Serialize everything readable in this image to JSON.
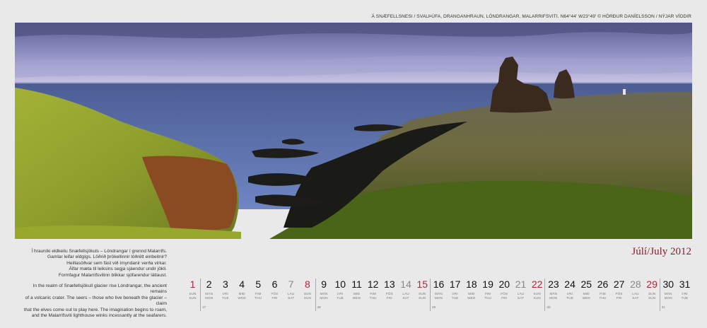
{
  "photo_caption": "Á Snæfellsnesi / Svalþúfa, Dranganhraun, Lóndrangar, Malarrifsviti. N64°44' W23°49' © Hörður Daníelsson / Nýjar víddir",
  "poem_is": [
    "Í hrauníki eldkeilu Snæfellsjökuls – Lóndrangar í grennd Malarrifs.",
    "Gamlar leifar eldgígs. Löðrið þrökellinnir löðrétt einbeitnir?",
    "Heillasöðvar sem fást við ímyndanir verða virkar.",
    "Álfar mæta til leiksins segja sjáendur undir jökli.",
    "Formfagur Malarrifsvitinn blikkar sjófarendur látlaust."
  ],
  "poem_en": [
    "In the realm of Snæfellsjökull glacier rise Lóndrangar, the ancient remains",
    "of a volcanic crater. The seers – those who live beneath the glacier – claim",
    "that the elves come out to play here. The imagination begins to roam,",
    "and the Malarrifsviti lighthouse winks incessantly at the seafarers."
  ],
  "month_title": "Júlí/July 2012",
  "week_numbers": [
    "27",
    "28",
    "29",
    "30",
    "31"
  ],
  "days": [
    {
      "n": "1",
      "is": "SUN",
      "en": "SUN",
      "type": "sun"
    },
    {
      "n": "2",
      "is": "MÁN",
      "en": "MON",
      "type": "wd"
    },
    {
      "n": "3",
      "is": "ÞRI",
      "en": "TUE",
      "type": "wd"
    },
    {
      "n": "4",
      "is": "MIÐ",
      "en": "WED",
      "type": "wd"
    },
    {
      "n": "5",
      "is": "FIM",
      "en": "THU",
      "type": "wd"
    },
    {
      "n": "6",
      "is": "FÖS",
      "en": "FRI",
      "type": "wd"
    },
    {
      "n": "7",
      "is": "LAU",
      "en": "SAT",
      "type": "sat"
    },
    {
      "n": "8",
      "is": "SUN",
      "en": "SUN",
      "type": "sun"
    },
    {
      "n": "9",
      "is": "MÁN",
      "en": "MON",
      "type": "wd"
    },
    {
      "n": "10",
      "is": "ÞRI",
      "en": "TUE",
      "type": "wd"
    },
    {
      "n": "11",
      "is": "MIÐ",
      "en": "WED",
      "type": "wd"
    },
    {
      "n": "12",
      "is": "FIM",
      "en": "THU",
      "type": "wd"
    },
    {
      "n": "13",
      "is": "FÖS",
      "en": "FRI",
      "type": "wd"
    },
    {
      "n": "14",
      "is": "LAU",
      "en": "SAT",
      "type": "sat"
    },
    {
      "n": "15",
      "is": "SUN",
      "en": "SUN",
      "type": "sun"
    },
    {
      "n": "16",
      "is": "MÁN",
      "en": "MON",
      "type": "wd"
    },
    {
      "n": "17",
      "is": "ÞRI",
      "en": "TUE",
      "type": "wd"
    },
    {
      "n": "18",
      "is": "MIÐ",
      "en": "WED",
      "type": "wd"
    },
    {
      "n": "19",
      "is": "FIM",
      "en": "THU",
      "type": "wd"
    },
    {
      "n": "20",
      "is": "FÖS",
      "en": "FRI",
      "type": "wd"
    },
    {
      "n": "21",
      "is": "LAU",
      "en": "SAT",
      "type": "sat"
    },
    {
      "n": "22",
      "is": "SUN",
      "en": "SUN",
      "type": "sun"
    },
    {
      "n": "23",
      "is": "MÁN",
      "en": "MON",
      "type": "wd"
    },
    {
      "n": "24",
      "is": "ÞRI",
      "en": "TUE",
      "type": "wd"
    },
    {
      "n": "25",
      "is": "MIÐ",
      "en": "WED",
      "type": "wd"
    },
    {
      "n": "26",
      "is": "FIM",
      "en": "THU",
      "type": "wd"
    },
    {
      "n": "27",
      "is": "FÖS",
      "en": "FRI",
      "type": "wd"
    },
    {
      "n": "28",
      "is": "LAU",
      "en": "SAT",
      "type": "sat"
    },
    {
      "n": "29",
      "is": "SUN",
      "en": "SUN",
      "type": "sun"
    },
    {
      "n": "30",
      "is": "MÁN",
      "en": "MON",
      "type": "wd"
    },
    {
      "n": "31",
      "is": "ÞRI",
      "en": "TUE",
      "type": "wd"
    }
  ],
  "colors": {
    "sunday": "#b5263a",
    "saturday": "#888888",
    "weekday": "#111111",
    "accent": "#8b1c2b"
  }
}
